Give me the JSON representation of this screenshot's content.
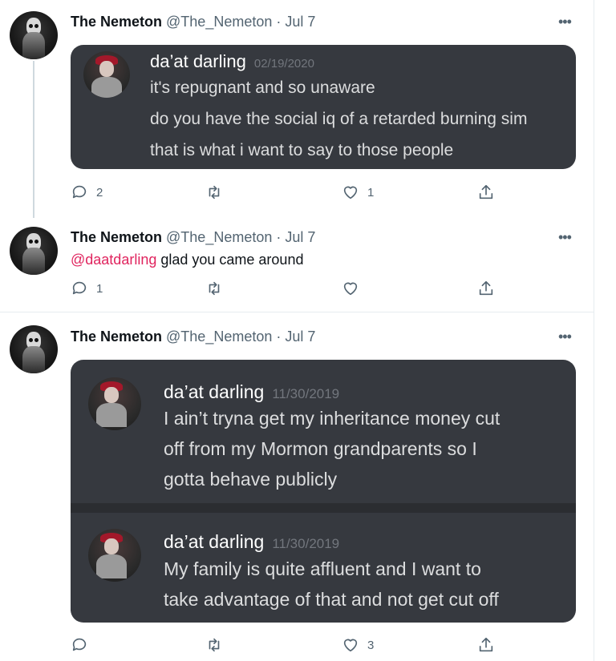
{
  "tweets": [
    {
      "name": "The Nemeton",
      "handle": "@The_Nemeton",
      "dot": "·",
      "date": "Jul 7",
      "more": "•••",
      "screenshot": {
        "messages": [
          {
            "username": "da’at darling",
            "timestamp": "02/19/2020",
            "lines": [
              "it's repugnant and so unaware",
              "do you have the social iq of a retarded burning sim",
              "that is what i want to say to those people"
            ]
          }
        ]
      },
      "actions": {
        "reply_count": "2",
        "retweet_count": "",
        "like_count": "1"
      }
    },
    {
      "name": "The Nemeton",
      "handle": "@The_Nemeton",
      "dot": "·",
      "date": "Jul 7",
      "more": "•••",
      "reply": {
        "mention": "@daatdarling",
        "text": " glad you came around"
      },
      "actions": {
        "reply_count": "1",
        "retweet_count": "",
        "like_count": ""
      }
    },
    {
      "name": "The Nemeton",
      "handle": "@The_Nemeton",
      "dot": "·",
      "date": "Jul 7",
      "more": "•••",
      "screenshot": {
        "messages": [
          {
            "username": "da’at darling",
            "timestamp": "11/30/2019",
            "lines": [
              "I ain’t tryna get my inheritance money cut",
              "off from my Mormon grandparents so I",
              "gotta behave publicly"
            ]
          },
          {
            "username": "da’at darling",
            "timestamp": "11/30/2019",
            "lines": [
              "My family is quite affluent and I want to",
              "take advantage of that and not get cut off"
            ]
          }
        ]
      },
      "actions": {
        "reply_count": "",
        "retweet_count": "",
        "like_count": "3"
      }
    }
  ],
  "icons": [
    "reply-icon",
    "retweet-icon",
    "like-icon",
    "share-icon",
    "more-icon"
  ],
  "colors": {
    "mention": "#e0245e",
    "card_bg": "#36393f",
    "secondary_text": "#536471"
  }
}
